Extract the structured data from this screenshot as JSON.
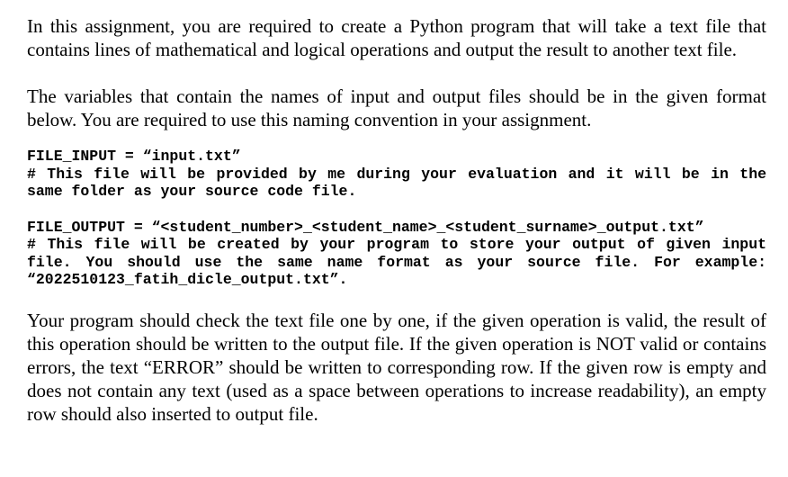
{
  "paragraphs": {
    "intro": "In this assignment, you are required to create a Python program that will take a text file that contains lines of mathematical and logical operations and output the result to another text file.",
    "naming": "The variables that contain the names of input and output files should be in the given format below. You are required to use this naming convention in your assignment.",
    "behavior": "Your program should check the text file one by one, if the given operation is valid, the result of this operation should be written to the output file. If the given operation is NOT valid or contains errors, the text “ERROR” should be written to corresponding row. If the given row is empty and does not contain any text (used as a space between operations to increase readability), an empty row should also inserted to output file."
  },
  "code": {
    "input_decl": "FILE_INPUT = “input.txt”",
    "input_comment": "# This file will be provided by me during your evaluation and it will be in the same folder as your source code file.",
    "output_decl": "FILE_OUTPUT = “<student_number>_<student_name>_<student_surname>_output.txt”",
    "output_comment": "# This file will be created by your program to store your output of given input file. You should use the same name format as your source file. For example: “2022510123_fatih_dicle_output.txt”."
  }
}
